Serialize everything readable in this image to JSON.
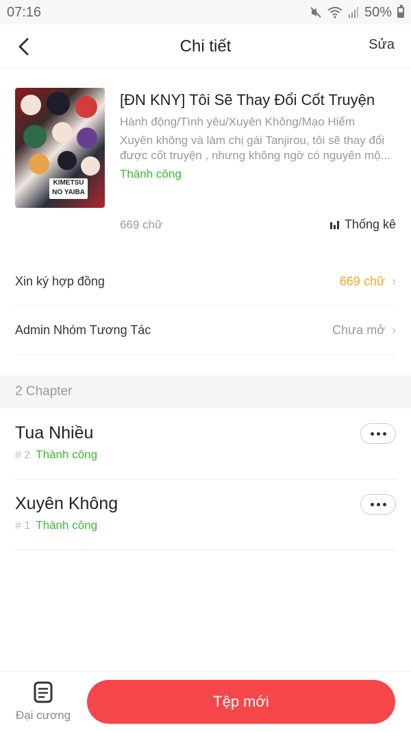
{
  "status_bar": {
    "time": "07:16",
    "battery": "50%",
    "icons": [
      "mute-icon",
      "wifi-icon",
      "signal-icon",
      "battery-icon"
    ]
  },
  "header": {
    "title": "Chi tiết",
    "edit_label": "Sửa",
    "back_icon": "back-arrow-icon"
  },
  "book": {
    "title": "[ĐN KNY] Tôi Sẽ Thay Đổi Cốt Truyện",
    "genres": "Hành động/Tình yêu/Xuyên Không/Mạo Hiểm",
    "description": "Xuyên không và làm chị gái Tanjirou, tôi sẽ thay đổi được cốt truyện , nhưng không ngờ có nguyên mộ...",
    "status": "Thành công",
    "word_count": "669 chữ",
    "stats_label": "Thống kê",
    "cover_logo_text": "KIMETSU NO YAIBA"
  },
  "rows": [
    {
      "label": "Xin ký hợp đồng",
      "value": "669 chữ",
      "value_color": "#f5a623"
    },
    {
      "label": "Admin Nhóm Tương Tác",
      "value": "Chưa mở",
      "value_color": "#999999"
    }
  ],
  "chapters_section": {
    "title": "2 Chapter"
  },
  "chapters": [
    {
      "title": "Tua Nhiều",
      "number": "# 2",
      "status": "Thành công"
    },
    {
      "title": "Xuyên Không",
      "number": "# 1",
      "status": "Thành công"
    }
  ],
  "bottom_bar": {
    "outline_label": "Đại cương",
    "new_file_label": "Tệp mới"
  },
  "colors": {
    "accent": "#f5474a",
    "success": "#3cb835",
    "warning": "#f5a623"
  }
}
